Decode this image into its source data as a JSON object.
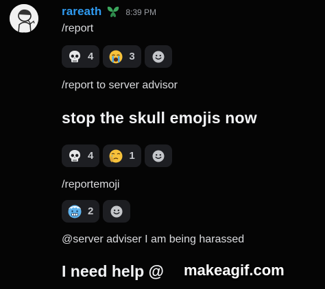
{
  "author": {
    "name": "rareath",
    "timestamp": "8:39 PM",
    "avatar_icon": "sketch-avatar-icon",
    "role_icon": "green-leaf-role-icon",
    "name_color": "#2f9bf1"
  },
  "messages": [
    {
      "text": "/report",
      "reactions": [
        {
          "emoji": "skull",
          "count": "4"
        },
        {
          "emoji": "crying-face",
          "count": "3"
        }
      ]
    },
    {
      "text": "/report to server advisor",
      "reactions": []
    },
    {
      "text": "stop the skull emojis now",
      "reactions": [
        {
          "emoji": "skull",
          "count": "4"
        },
        {
          "emoji": "face-holding-back-tears",
          "count": "1"
        }
      ]
    },
    {
      "text": "/reportemoji",
      "reactions": [
        {
          "emoji": "cold-face",
          "count": "2"
        }
      ]
    },
    {
      "text": "@server adviser I am being harassed",
      "reactions": []
    },
    {
      "text": "I need help @",
      "reactions": []
    }
  ],
  "watermark": "makeagif.com",
  "colors": {
    "background": "#050505",
    "reaction_bg": "#1d1e22",
    "text": "#dcdde0"
  }
}
